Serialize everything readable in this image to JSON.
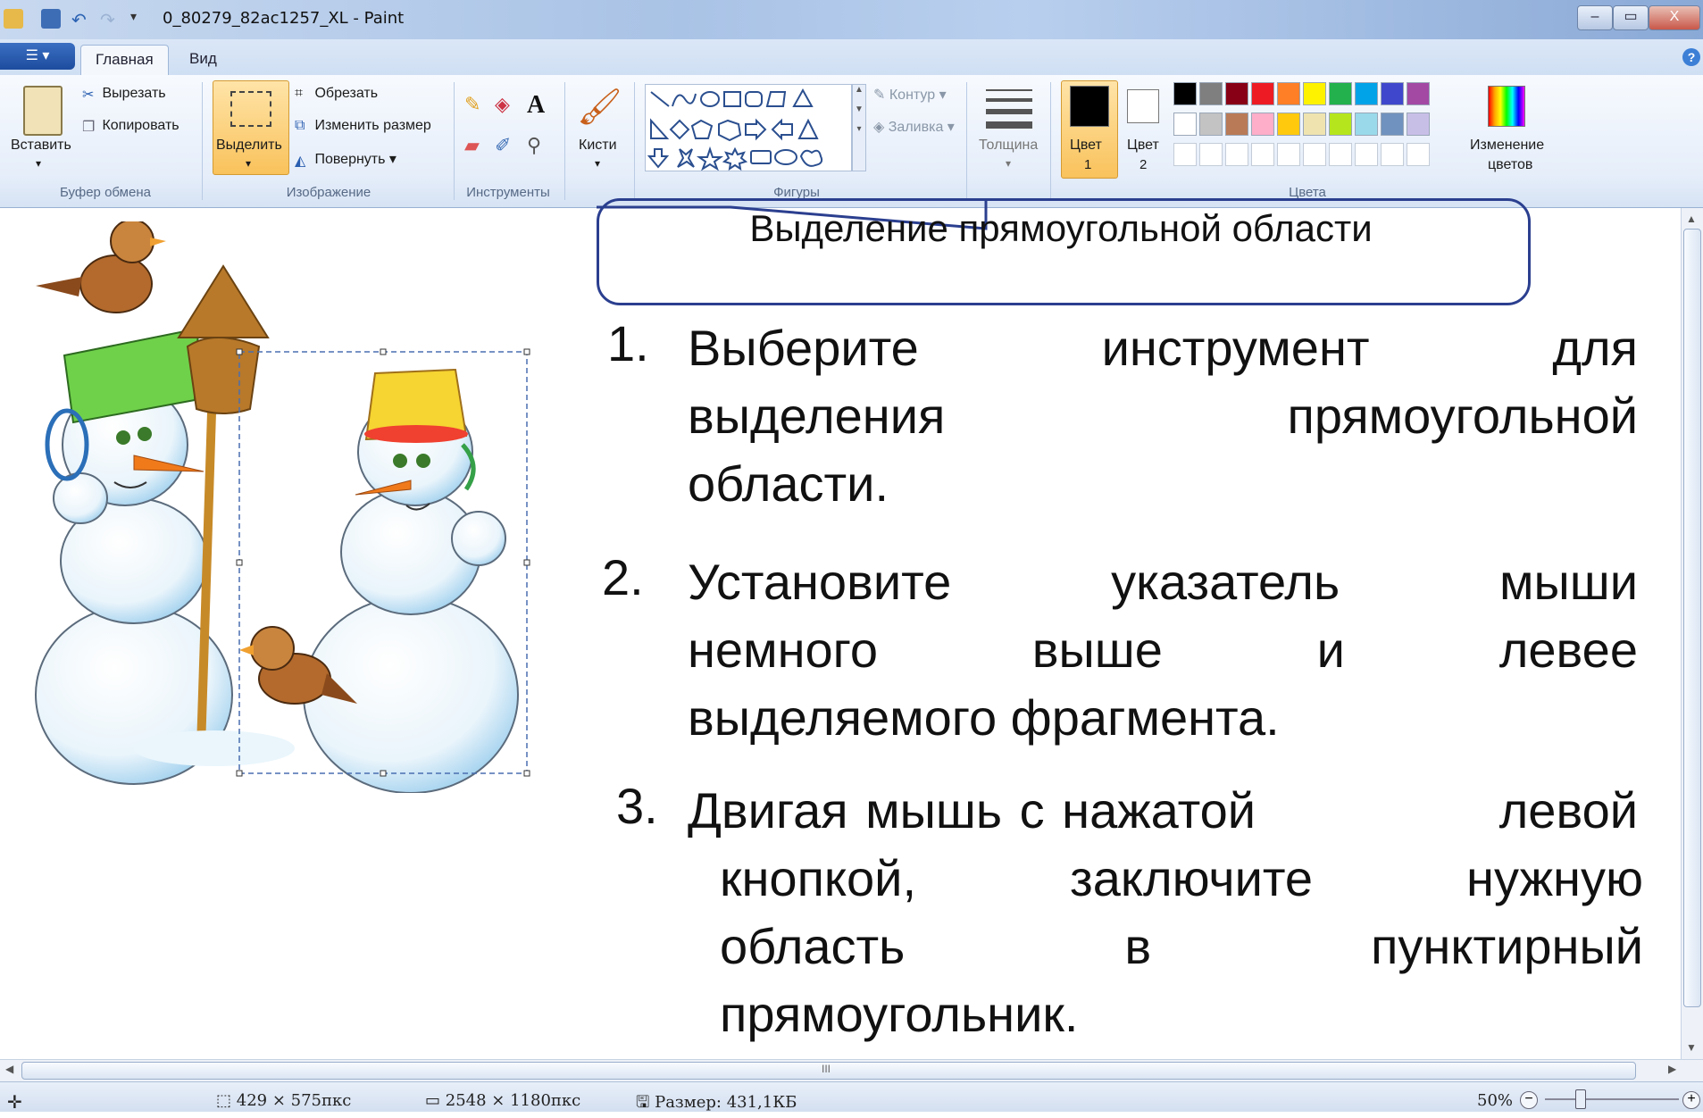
{
  "window": {
    "title": "0_80279_82ac1257_XL - Paint",
    "controls": [
      "–",
      "▭",
      "X"
    ]
  },
  "ribbon": {
    "tabs": [
      {
        "label": "Главная"
      },
      {
        "label": "Вид"
      }
    ],
    "clipboard": {
      "paste": "Вставить",
      "cut": "Вырезать",
      "copy": "Копировать",
      "group": "Буфер обмена"
    },
    "image": {
      "select": "Выделить",
      "crop": "Обрезать",
      "resize": "Изменить размер",
      "rotate": "Повернуть",
      "group": "Изображение"
    },
    "tools": {
      "group": "Инструменты",
      "text_tool": "A"
    },
    "brushes": {
      "label": "Кисти"
    },
    "shapes": {
      "outline": "Контур",
      "fill": "Заливка",
      "group": "Фигуры"
    },
    "size": {
      "label": "Толщина"
    },
    "colors": {
      "color1_label": "Цвет",
      "color1_num": "1",
      "color2_label": "Цвет",
      "color2_num": "2",
      "edit": "Изменение",
      "edit2": "цветов",
      "group": "Цвета",
      "row1": [
        "#000000",
        "#7f7f7f",
        "#880015",
        "#ed1c24",
        "#ff7f27",
        "#fff200",
        "#22b14c",
        "#00a2e8",
        "#3f48cc",
        "#a349a4"
      ],
      "row2": [
        "#ffffff",
        "#c3c3c3",
        "#b97a57",
        "#ffaec9",
        "#ffc90e",
        "#efe4b0",
        "#b5e61d",
        "#99d9ea",
        "#7092be",
        "#c8bfe7"
      ]
    }
  },
  "callout": {
    "text": "Выделение прямоугольной области"
  },
  "steps": [
    {
      "num": "1.",
      "lines": [
        [
          "Выберите",
          "инструмент",
          "для"
        ],
        [
          "выделения",
          "прямоугольной"
        ],
        [
          "области."
        ]
      ]
    },
    {
      "num": "2.",
      "lines": [
        [
          "Установите",
          "указатель",
          "мыши"
        ],
        [
          "немного",
          "выше",
          "и",
          "левее"
        ],
        [
          "выделяемого фрагмента."
        ]
      ]
    },
    {
      "num": "3.",
      "lines": [
        [
          "Двигая мышь с нажатой",
          "левой"
        ],
        [
          "кнопкой,",
          "заключите",
          "нужную"
        ],
        [
          "область",
          "в",
          "пунктирный"
        ],
        [
          "прямоугольник."
        ]
      ]
    }
  ],
  "statusbar": {
    "selection_size": "429 × 575пкс",
    "image_size": "2548 × 1180пкс",
    "file_size": "Размер: 431,1КБ",
    "zoom": "50%"
  },
  "hscroll_grip": "III"
}
